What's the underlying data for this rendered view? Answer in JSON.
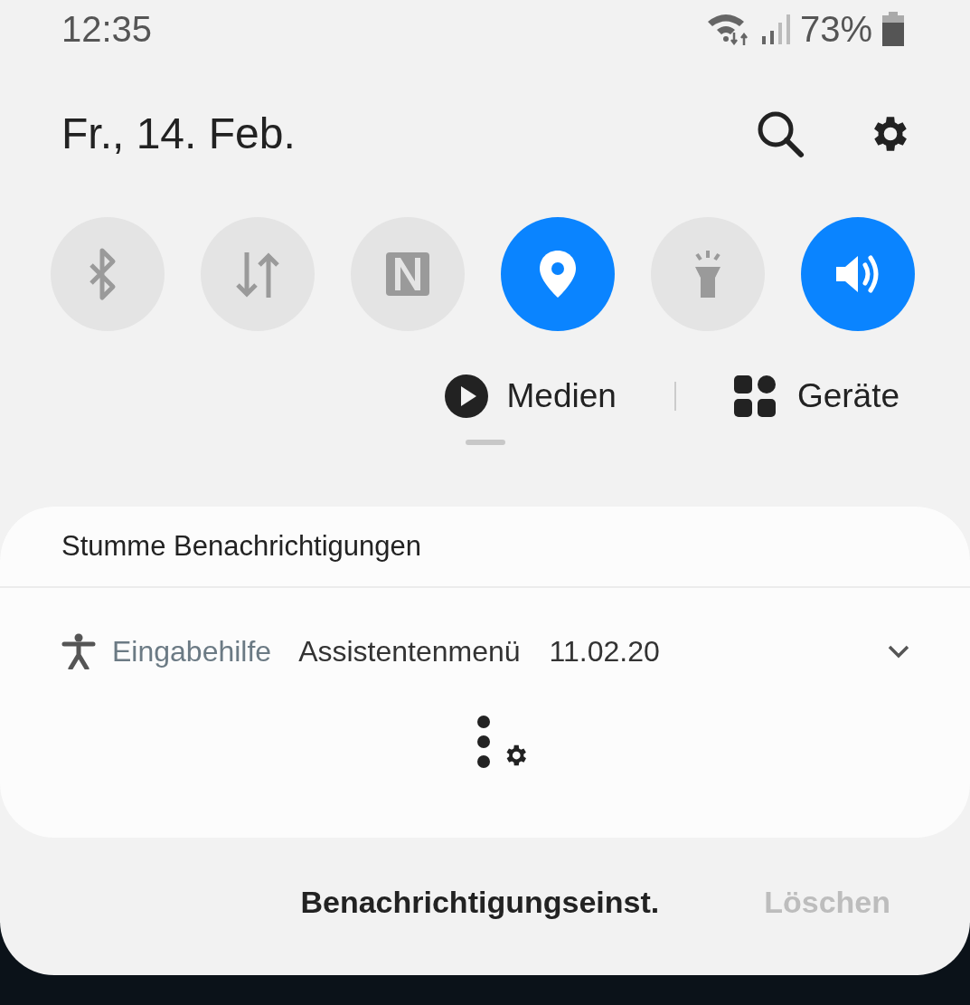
{
  "status_bar": {
    "time": "12:35",
    "battery_percent": "73%"
  },
  "header": {
    "date": "Fr., 14. Feb."
  },
  "quick_toggles": [
    {
      "kind": "bluetooth",
      "on": false
    },
    {
      "kind": "data",
      "on": false
    },
    {
      "kind": "nfc",
      "on": false
    },
    {
      "kind": "location",
      "on": true
    },
    {
      "kind": "flashlight",
      "on": false
    },
    {
      "kind": "sound",
      "on": true
    }
  ],
  "media_row": {
    "media": "Medien",
    "devices": "Geräte"
  },
  "notifications": {
    "section_title": "Stumme Benachrichtigungen",
    "items": [
      {
        "app": "Eingabehilfe",
        "title": "Assistentenmenü",
        "date": "11.02.20"
      }
    ]
  },
  "footer": {
    "settings_button": "Benachrichtigungseinst.",
    "clear_button": "Löschen"
  }
}
